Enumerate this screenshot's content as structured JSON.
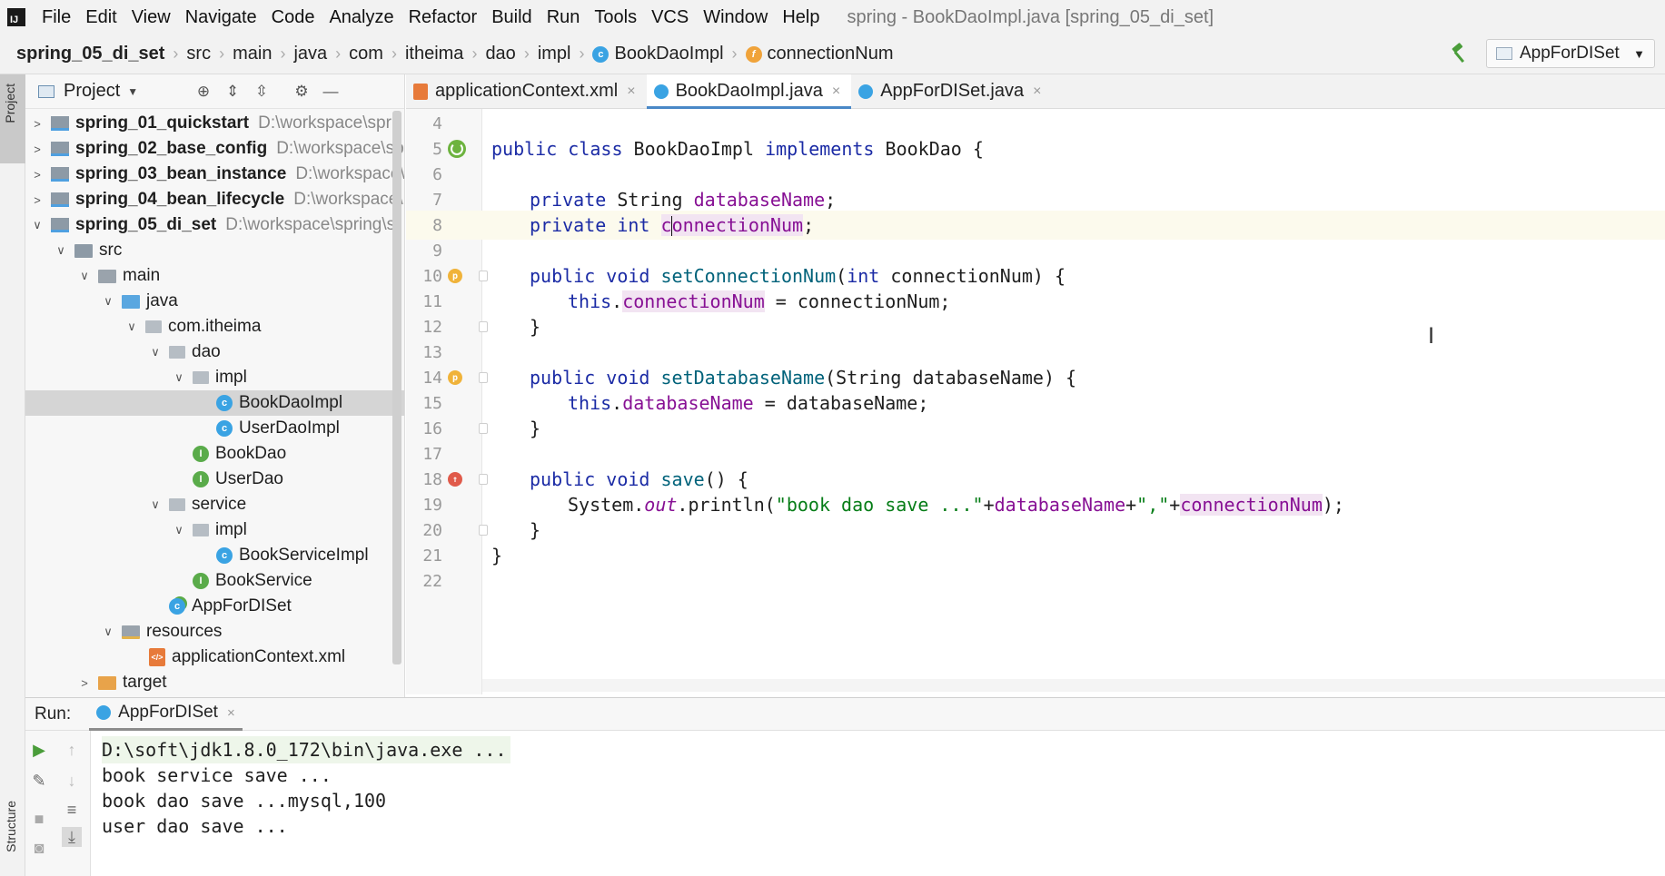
{
  "app": {
    "logo_text": "IJ",
    "window_title": "spring - BookDaoImpl.java [spring_05_di_set]"
  },
  "menu": [
    "File",
    "Edit",
    "View",
    "Navigate",
    "Code",
    "Analyze",
    "Refactor",
    "Build",
    "Run",
    "Tools",
    "VCS",
    "Window",
    "Help"
  ],
  "breadcrumb": [
    "spring_05_di_set",
    "src",
    "main",
    "java",
    "com",
    "itheima",
    "dao",
    "impl",
    "BookDaoImpl",
    "connectionNum"
  ],
  "run_config": "AppForDISet",
  "left_strip": {
    "project_label": "Project",
    "structure_label": "Structure"
  },
  "project_panel": {
    "title": "Project",
    "tree": [
      {
        "name": "spring_01_quickstart",
        "path": "D:\\workspace\\spri",
        "bold": true
      },
      {
        "name": "spring_02_base_config",
        "path": "D:\\workspace\\sp",
        "bold": true
      },
      {
        "name": "spring_03_bean_instance",
        "path": "D:\\workspace\\",
        "bold": true
      },
      {
        "name": "spring_04_bean_lifecycle",
        "path": "D:\\workspace\\",
        "bold": true
      },
      {
        "name": "spring_05_di_set",
        "path": "D:\\workspace\\spring\\s",
        "bold": true
      },
      {
        "name": "src"
      },
      {
        "name": "main"
      },
      {
        "name": "java"
      },
      {
        "name": "com.itheima"
      },
      {
        "name": "dao"
      },
      {
        "name": "impl"
      },
      {
        "name": "BookDaoImpl"
      },
      {
        "name": "UserDaoImpl"
      },
      {
        "name": "BookDao"
      },
      {
        "name": "UserDao"
      },
      {
        "name": "service"
      },
      {
        "name": "impl"
      },
      {
        "name": "BookServiceImpl"
      },
      {
        "name": "BookService"
      },
      {
        "name": "AppForDISet"
      },
      {
        "name": "resources"
      },
      {
        "name": "applicationContext.xml"
      },
      {
        "name": "target"
      }
    ]
  },
  "editor_tabs": [
    {
      "label": "applicationContext.xml"
    },
    {
      "label": "BookDaoImpl.java"
    },
    {
      "label": "AppForDISet.java"
    }
  ],
  "editor": {
    "line_numbers": [
      "4",
      "5",
      "6",
      "7",
      "8",
      "9",
      "10",
      "11",
      "12",
      "13",
      "14",
      "15",
      "16",
      "17",
      "18",
      "19",
      "20",
      "21",
      "22"
    ],
    "code": {
      "l5_public": "public",
      "l5_class": "class",
      "l5_name": " BookDaoImpl ",
      "l5_implements": "implements",
      "l5_rest": " BookDao {",
      "l7_private": "private",
      "l7_type": " String ",
      "l7_field": "databaseName",
      "l7_end": ";",
      "l8_private": "private",
      "l8_int": "int",
      "l8_field_pre": "c",
      "l8_field_post": "onnectionNum",
      "l8_end": ";",
      "l10_public": "public",
      "l10_void": "void",
      "l10_method": "setConnectionNum",
      "l10_open": "(",
      "l10_int": "int",
      "l10_rest": " connectionNum) {",
      "l11_this": "this",
      "l11_dot": ".",
      "l11_field": "connectionNum",
      "l11_rest": " = connectionNum;",
      "l12": "}",
      "l14_public": "public",
      "l14_void": "void",
      "l14_method": "setDatabaseName",
      "l14_rest": "(String databaseName) {",
      "l15_this": "this",
      "l15_dot": ".",
      "l15_field": "databaseName",
      "l15_rest": " = databaseName;",
      "l16": "}",
      "l18_public": "public",
      "l18_void": "void",
      "l18_method": "save",
      "l18_rest": "() {",
      "l19_system": "System.",
      "l19_out": "out",
      "l19_println": ".println(",
      "l19_str1": "\"book dao save ...\"",
      "l19_plus1": "+",
      "l19_field1": "databaseName",
      "l19_plus2": "+",
      "l19_str2": "\",\"",
      "l19_plus3": "+",
      "l19_field2": "connectionNum",
      "l19_end": ");",
      "l20": "}",
      "l21": "}"
    }
  },
  "run_panel": {
    "label": "Run:",
    "tab": "AppForDISet",
    "console": [
      "D:\\soft\\jdk1.8.0_172\\bin\\java.exe ...",
      "book service save ...",
      "book dao save ...mysql,100",
      "user dao save ..."
    ]
  },
  "colors": {
    "keyword": "#1b2ba5",
    "field": "#871094",
    "string": "#067d17",
    "method": "#00627a",
    "selection": "#d5d5d5",
    "tab_accent": "#4a88c7"
  }
}
